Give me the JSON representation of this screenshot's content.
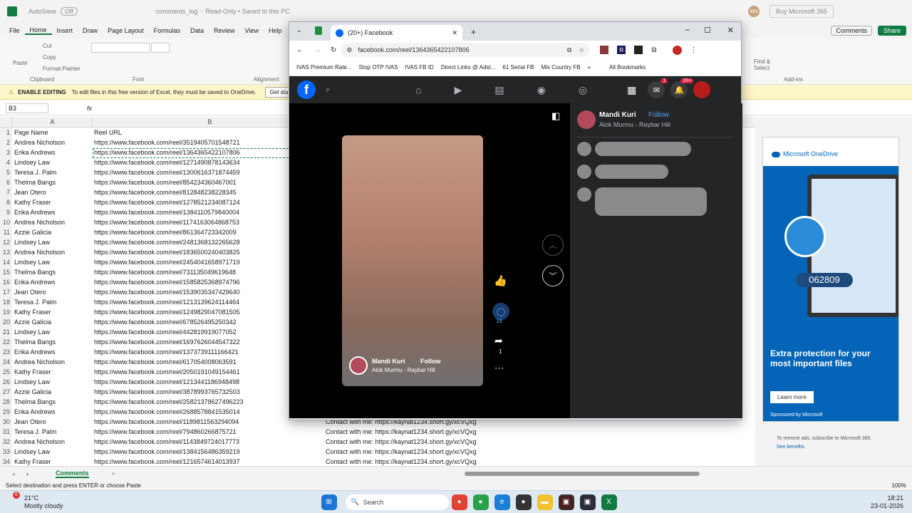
{
  "excel": {
    "autosave": "AutoSave",
    "autosave_state": "Off",
    "file_name": "comments_log",
    "file_status": "Read-Only • Saved to this PC",
    "user_initials": "MN",
    "buy_label": "Buy Microsoft 365",
    "menu": [
      "File",
      "Home",
      "Insert",
      "Draw",
      "Page Layout",
      "Formulas",
      "Data",
      "Review",
      "View",
      "Help"
    ],
    "comments_btn": "Comments",
    "share_btn": "Share",
    "ribbon": {
      "paste": "Paste",
      "cut": "Cut",
      "copy": "Copy",
      "format_painter": "Format Painter",
      "clipboard": "Clipboard",
      "font": "Font",
      "alignment": "Alignment",
      "find_select": "Find & Select",
      "addins": "Add-ins"
    },
    "message_label": "ENABLE EDITING",
    "message_text": "To edit files in this free version of Excel, they must be saved to OneDrive.",
    "message_button": "Get started",
    "name_box": "B3",
    "formula_fx": "fx",
    "col_a": "A",
    "col_b": "B",
    "rows": [
      {
        "n": "1",
        "a": "Page Name",
        "b": "Reel URL",
        "c": ""
      },
      {
        "n": "2",
        "a": "Andrea Nicholson",
        "b": "https://www.facebook.com/reel/3519405701548721",
        "c": ""
      },
      {
        "n": "3",
        "a": "Erika Andrews",
        "b": "https://www.facebook.com/reel/1364365422107806",
        "c": ""
      },
      {
        "n": "4",
        "a": "Lindsey Law",
        "b": "https://www.facebook.com/reel/1271490878143634",
        "c": ""
      },
      {
        "n": "5",
        "a": "Teresa J. Palm",
        "b": "https://www.facebook.com/reel/1300616371874459",
        "c": ""
      },
      {
        "n": "6",
        "a": "Thelma Bangs",
        "b": "https://www.facebook.com/reel/854234360467001",
        "c": ""
      },
      {
        "n": "7",
        "a": "Jean Otero",
        "b": "https://www.facebook.com/reel/812848238228345",
        "c": ""
      },
      {
        "n": "8",
        "a": "Kathy Fraser",
        "b": "https://www.facebook.com/reel/1278521234087124",
        "c": ""
      },
      {
        "n": "9",
        "a": "Erika Andrews",
        "b": "https://www.facebook.com/reel/1384110579840004",
        "c": ""
      },
      {
        "n": "10",
        "a": "Andrea Nicholson",
        "b": "https://www.facebook.com/reel/1174163064868753",
        "c": ""
      },
      {
        "n": "11",
        "a": "Azzie Galicia",
        "b": "https://www.facebook.com/reel/861364723342009",
        "c": ""
      },
      {
        "n": "12",
        "a": "Lindsey Law",
        "b": "https://www.facebook.com/reel/2481368132265628",
        "c": ""
      },
      {
        "n": "13",
        "a": "Andrea Nicholson",
        "b": "https://www.facebook.com/reel/1836500240403825",
        "c": ""
      },
      {
        "n": "14",
        "a": "Lindsey Law",
        "b": "https://www.facebook.com/reel/2454041658971719",
        "c": ""
      },
      {
        "n": "15",
        "a": "Thelma Bangs",
        "b": "https://www.facebook.com/reel/731135049619648",
        "c": ""
      },
      {
        "n": "16",
        "a": "Erika Andrews",
        "b": "https://www.facebook.com/reel/1585825368974796",
        "c": ""
      },
      {
        "n": "17",
        "a": "Jean Otero",
        "b": "https://www.facebook.com/reel/1539035347429640",
        "c": ""
      },
      {
        "n": "18",
        "a": "Teresa J. Palm",
        "b": "https://www.facebook.com/reel/1213139624114464",
        "c": ""
      },
      {
        "n": "19",
        "a": "Kathy Fraser",
        "b": "https://www.facebook.com/reel/1249829047081505",
        "c": ""
      },
      {
        "n": "20",
        "a": "Azzie Galicia",
        "b": "https://www.facebook.com/reel/678526495250342",
        "c": ""
      },
      {
        "n": "21",
        "a": "Lindsey Law",
        "b": "https://www.facebook.com/reel/442819919077052",
        "c": ""
      },
      {
        "n": "22",
        "a": "Thelma Bangs",
        "b": "https://www.facebook.com/reel/1697626044547322",
        "c": ""
      },
      {
        "n": "23",
        "a": "Erika Andrews",
        "b": "https://www.facebook.com/reel/1373739111166421",
        "c": ""
      },
      {
        "n": "24",
        "a": "Andrea Nicholson",
        "b": "https://www.facebook.com/reel/617054008063591",
        "c": ""
      },
      {
        "n": "25",
        "a": "Kathy Fraser",
        "b": "https://www.facebook.com/reel/2050191049154461",
        "c": ""
      },
      {
        "n": "26",
        "a": "Lindsey Law",
        "b": "https://www.facebook.com/reel/1213441186948498",
        "c": ""
      },
      {
        "n": "27",
        "a": "Azzie Galicia",
        "b": "https://www.facebook.com/reel/3878993765732503",
        "c": ""
      },
      {
        "n": "28",
        "a": "Thelma Bangs",
        "b": "https://www.facebook.com/reel/25821378627496223",
        "c": ""
      },
      {
        "n": "29",
        "a": "Erika Andrews",
        "b": "https://www.facebook.com/reel/2688578841535014",
        "c": ""
      },
      {
        "n": "30",
        "a": "Jean Otero",
        "b": "https://www.facebook.com/reel/1189811563294094",
        "c": "Contact with me: https://kaynat1234.short.gy/xcVQxg"
      },
      {
        "n": "31",
        "a": "Teresa J. Palm",
        "b": "https://www.facebook.com/reel/794860266875721",
        "c": "Contact with me: https://kaynat1234.short.gy/xcVQxg"
      },
      {
        "n": "32",
        "a": "Andrea Nicholson",
        "b": "https://www.facebook.com/reel/1143849724017773",
        "c": "Contact with me: https://kaynat1234.short.gy/xcVQxg"
      },
      {
        "n": "33",
        "a": "Lindsey Law",
        "b": "https://www.facebook.com/reel/1384156486359219",
        "c": "Contact with me: https://kaynat1234.short.gy/xcVQxg"
      },
      {
        "n": "34",
        "a": "Kathy Fraser",
        "b": "https://www.facebook.com/reel/1216574614013937",
        "c": "Contact with me: https://kaynat1234.short.gy/xcVQxg"
      }
    ],
    "sheet_tab": "Comments",
    "status_text": "Select destination and press ENTER or choose Paste",
    "zoom": "100%",
    "ad": {
      "brand": "Microsoft OneDrive",
      "code": "062809",
      "headline": "Extra protection for your most important files",
      "button": "Learn more",
      "sponsor": "Sponsored by Microsoft",
      "remove": "To remove ads, subscribe to Microsoft 365.",
      "benefits": "See benefits"
    }
  },
  "chrome": {
    "tab_title": "(20+) Facebook",
    "url": "facebook.com/reel/1364365422107806",
    "bookmarks": [
      "IVAS Premium Rate...",
      "Stop OTP IVAS",
      "IVAS FB ID",
      "Direct Links @ Adst...",
      "61 Serial FB",
      "Mix Country FB"
    ],
    "all_bookmarks": "All Bookmarks"
  },
  "facebook": {
    "messenger_badge": "1",
    "notif_badge": "20+",
    "author": "Mandi Kuri",
    "follow": "Follow",
    "song": "Alok Murmu - Raybar Hili",
    "comments_count": "18",
    "shares_count": "1",
    "video_author": "Mandi Kuri",
    "video_follow": "Follow",
    "video_song": "Alok Murmu - Raybar Hili"
  },
  "taskbar": {
    "temp": "21°C",
    "weather": "Mostly cloudy",
    "weather_badge": "6",
    "search": "Search",
    "time": "18:21",
    "date": "23-01-2026"
  },
  "colors": {
    "excel_green": "#107c41",
    "fb_blue": "#0866ff",
    "fb_dark": "#242526",
    "taskbar": "#dfe9f2"
  }
}
